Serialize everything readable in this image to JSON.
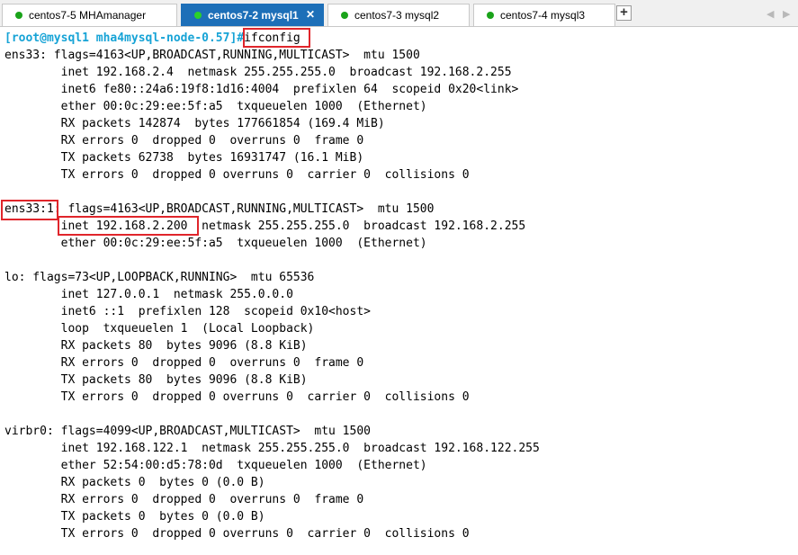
{
  "tabs": [
    {
      "label": "centos7-5 MHAmanager",
      "active": false
    },
    {
      "label": "centos7-2 mysql1",
      "active": true
    },
    {
      "label": "centos7-3 mysql2",
      "active": false
    },
    {
      "label": "centos7-4 mysql3",
      "active": false
    }
  ],
  "tab_close_glyph": "✕",
  "add_tab_glyph": "+",
  "scroll_left_glyph": "◀",
  "scroll_right_glyph": "▶",
  "terminal": {
    "prompt": "[root@mysql1 mha4mysql-node-0.57]#",
    "command": "ifconfig",
    "prompt_color": "#16a3d6",
    "highlight_color": "#e0252b",
    "output": [
      "ens33: flags=4163<UP,BROADCAST,RUNNING,MULTICAST>  mtu 1500",
      "        inet 192.168.2.4  netmask 255.255.255.0  broadcast 192.168.2.255",
      "        inet6 fe80::24a6:19f8:1d16:4004  prefixlen 64  scopeid 0x20<link>",
      "        ether 00:0c:29:ee:5f:a5  txqueuelen 1000  (Ethernet)",
      "        RX packets 142874  bytes 177661854 (169.4 MiB)",
      "        RX errors 0  dropped 0  overruns 0  frame 0",
      "        TX packets 62738  bytes 16931747 (16.1 MiB)",
      "        TX errors 0  dropped 0 overruns 0  carrier 0  collisions 0",
      "",
      "ens33:1: flags=4163<UP,BROADCAST,RUNNING,MULTICAST>  mtu 1500",
      "        inet 192.168.2.200  netmask 255.255.255.0  broadcast 192.168.2.255",
      "        ether 00:0c:29:ee:5f:a5  txqueuelen 1000  (Ethernet)",
      "",
      "lo: flags=73<UP,LOOPBACK,RUNNING>  mtu 65536",
      "        inet 127.0.0.1  netmask 255.0.0.0",
      "        inet6 ::1  prefixlen 128  scopeid 0x10<host>",
      "        loop  txqueuelen 1  (Local Loopback)",
      "        RX packets 80  bytes 9096 (8.8 KiB)",
      "        RX errors 0  dropped 0  overruns 0  frame 0",
      "        TX packets 80  bytes 9096 (8.8 KiB)",
      "        TX errors 0  dropped 0 overruns 0  carrier 0  collisions 0",
      "",
      "virbr0: flags=4099<UP,BROADCAST,MULTICAST>  mtu 1500",
      "        inet 192.168.122.1  netmask 255.255.255.0  broadcast 192.168.122.255",
      "        ether 52:54:00:d5:78:0d  txqueuelen 1000  (Ethernet)",
      "        RX packets 0  bytes 0 (0.0 B)",
      "        RX errors 0  dropped 0  overruns 0  frame 0",
      "        TX packets 0  bytes 0 (0.0 B)",
      "        TX errors 0  dropped 0 overruns 0  carrier 0  collisions 0"
    ]
  }
}
